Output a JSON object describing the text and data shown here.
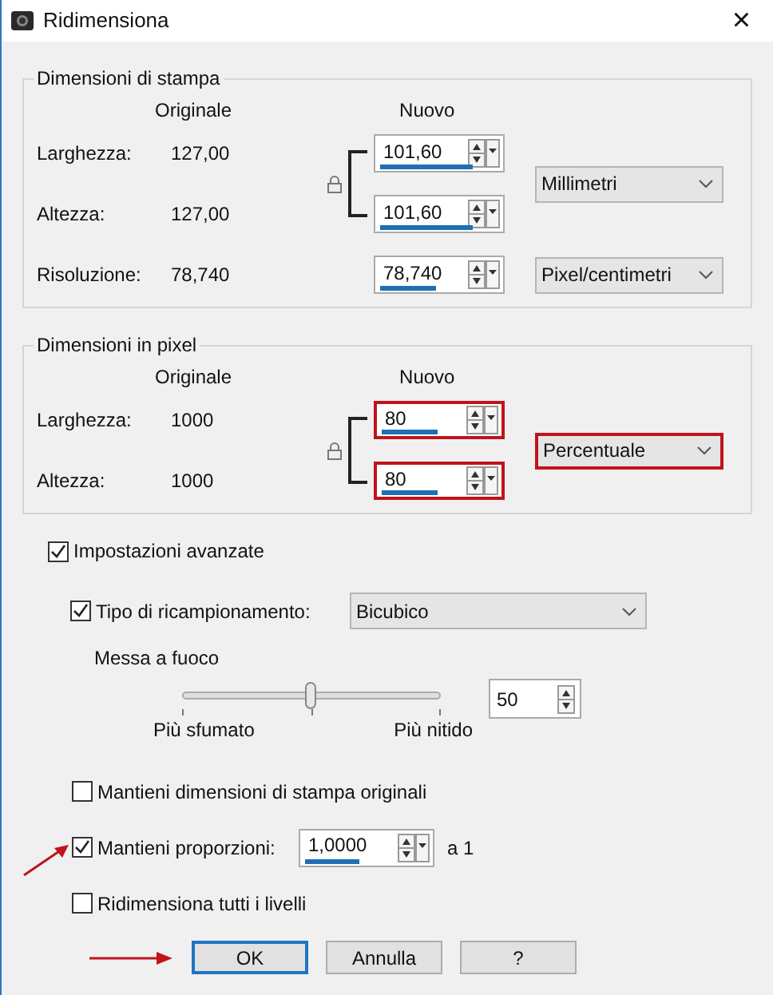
{
  "window": {
    "title": "Ridimensiona",
    "close": "×"
  },
  "groups": [
    {
      "title": "Dimensioni di stampa",
      "header_original": "Originale",
      "header_new": "Nuovo",
      "linked": true,
      "rows": [
        {
          "label": "Larghezza:",
          "original": "127,00",
          "value": "101,60",
          "highlighted": false
        },
        {
          "label": "Altezza:",
          "original": "127,00",
          "value": "101,60",
          "highlighted": false
        }
      ],
      "unit": {
        "value": "Millimetri",
        "highlighted": false
      },
      "extra": {
        "label": "Risoluzione:",
        "original": "78,740",
        "value": "78,740",
        "highlighted": false,
        "unit": "Pixel/centimetri"
      }
    },
    {
      "title": "Dimensioni in pixel",
      "header_original": "Originale",
      "header_new": "Nuovo",
      "linked": true,
      "rows": [
        {
          "label": "Larghezza:",
          "original": "1000",
          "value": "80",
          "highlighted": true
        },
        {
          "label": "Altezza:",
          "original": "1000",
          "value": "80",
          "highlighted": true
        }
      ],
      "unit": {
        "value": "Percentuale",
        "highlighted": true
      }
    }
  ],
  "advanced": {
    "label": "Impostazioni avanzate",
    "checked": true
  },
  "resampling": {
    "label": "Tipo di ricampionamento:",
    "checked": true,
    "method": "Bicubico"
  },
  "sharpness": {
    "label": "Messa a fuoco",
    "level": 0.5,
    "value": "50",
    "min_label": "Più sfumato",
    "max_label": "Più nitido"
  },
  "options": [
    {
      "kind": "checkbox",
      "label": "Mantieni dimensioni di stampa originali",
      "checked": false,
      "marked": false
    },
    {
      "kind": "ratio",
      "label": "Mantieni proporzioni:",
      "checked": true,
      "value": "1,0000",
      "suffix": "a 1",
      "marked": true
    },
    {
      "kind": "checkbox",
      "label": "Ridimensiona tutti i livelli",
      "checked": false,
      "marked": false
    }
  ],
  "buttons": [
    {
      "label": "OK",
      "default": true,
      "marked": true
    },
    {
      "label": "Annulla",
      "default": false,
      "marked": false
    },
    {
      "label": "?",
      "default": false,
      "marked": false
    }
  ]
}
